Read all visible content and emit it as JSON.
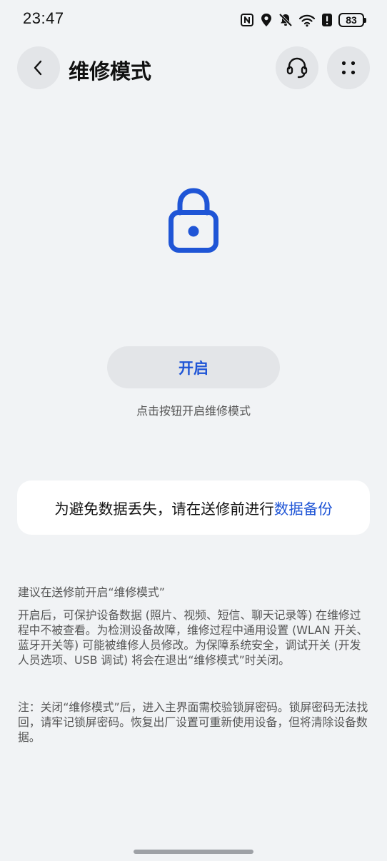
{
  "status_bar": {
    "time": "23:47",
    "battery_level": "83",
    "icons": [
      "nfc-icon",
      "location-icon",
      "bell-off-icon",
      "wifi-icon",
      "alert-icon",
      "battery-icon"
    ]
  },
  "header": {
    "title": "维修模式",
    "back_icon": "chevron-left-icon",
    "support_icon": "headset-icon",
    "more_icon": "more-dots-icon"
  },
  "main": {
    "lock_icon": "lock-icon",
    "enable_button": "开启",
    "enable_hint": "点击按钮开启维修模式"
  },
  "backup_card": {
    "text": "为避免数据丢失，请在送修前进行",
    "link": "数据备份"
  },
  "info": {
    "heading": "建议在送修前开启“维修模式”",
    "body": "开启后，可保护设备数据 (照片、视频、短信、聊天记录等) 在维修过程中不被查看。为检测设备故障，维修过程中通用设置 (WLAN 开关、蓝牙开关等) 可能被维修人员修改。为保障系统安全，调试开关 (开发人员选项、USB 调试) 将会在退出“维修模式”时关闭。",
    "note": "注：关闭“维修模式”后，进入主界面需校验锁屏密码。锁屏密码无法找回，请牢记锁屏密码。恢复出厂设置可重新使用设备，但将清除设备数据。"
  },
  "colors": {
    "accent": "#1f55d6",
    "background": "#f1f3f5",
    "button_bg": "#e3e5e8",
    "card_bg": "#ffffff",
    "secondary_text": "#555555"
  }
}
